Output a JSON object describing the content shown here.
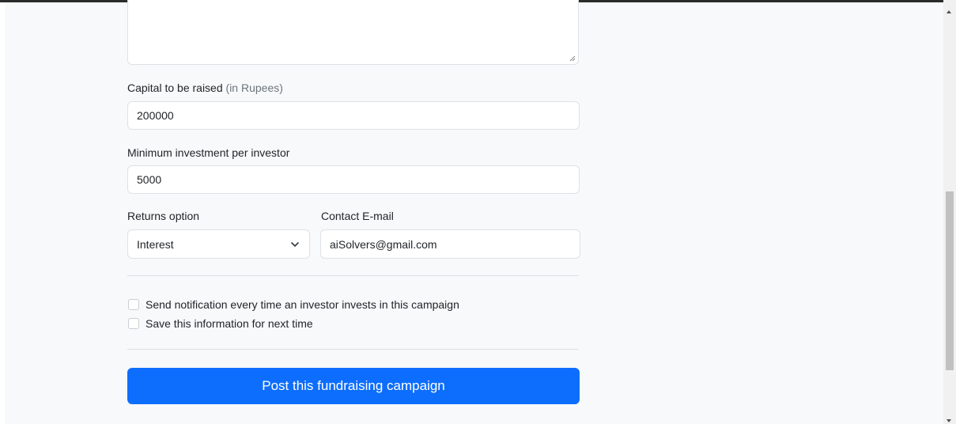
{
  "form": {
    "capital": {
      "label": "Capital to be raised",
      "label_hint": "(in Rupees)",
      "value": "200000"
    },
    "min_investment": {
      "label": "Minimum investment per investor",
      "value": "5000"
    },
    "returns": {
      "label": "Returns option",
      "selected": "Interest"
    },
    "contact": {
      "label": "Contact E-mail",
      "value": "aiSolvers@gmail.com"
    },
    "checkboxes": [
      {
        "label": "Send notification every time an investor invests in this campaign",
        "checked": false
      },
      {
        "label": "Save this information for next time",
        "checked": false
      }
    ],
    "submit_label": "Post this fundraising campaign"
  },
  "colors": {
    "primary": "#0d6efd",
    "page_bg": "#f8f9fa",
    "border": "#dee2e6",
    "muted_text": "#6c757d"
  },
  "icons": {
    "select_arrow": "chevron-down-icon",
    "textarea_grip": "resize-grip-icon"
  }
}
